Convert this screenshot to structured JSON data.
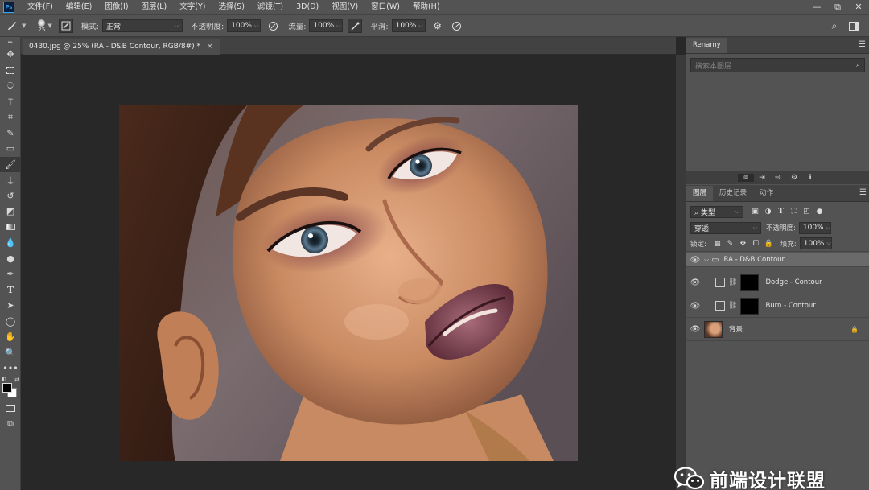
{
  "app": {
    "logo_text": "Ps"
  },
  "menu": [
    "文件(F)",
    "编辑(E)",
    "图像(I)",
    "图层(L)",
    "文字(Y)",
    "选择(S)",
    "滤镜(T)",
    "3D(D)",
    "视图(V)",
    "窗口(W)",
    "帮助(H)"
  ],
  "window_controls": {
    "minimize": "—",
    "restore": "⧉",
    "close": "✕"
  },
  "options_bar": {
    "brush_size": "25",
    "mode_label": "模式:",
    "mode_value": "正常",
    "opacity_label": "不透明度:",
    "opacity_value": "100%",
    "flow_label": "流量:",
    "flow_value": "100%",
    "smoothing_label": "平滑:",
    "smoothing_value": "100%"
  },
  "document": {
    "tab_title": "0430.jpg @ 25% (RA - D&B Contour, RGB/8#) *",
    "close_glyph": "×"
  },
  "renamy_panel": {
    "tab": "Renamy",
    "search_placeholder": "搜索本图层"
  },
  "layers_panel": {
    "tabs": [
      "图层",
      "历史记录",
      "动作"
    ],
    "filter_kind": "类型",
    "blend_mode": "穿透",
    "opacity_label": "不透明度:",
    "opacity_value": "100%",
    "lock_label": "锁定:",
    "fill_label": "填充:",
    "fill_value": "100%",
    "layers": [
      {
        "name": "RA - D&B Contour",
        "type": "group"
      },
      {
        "name": "Dodge - Contour",
        "type": "adjustment"
      },
      {
        "name": "Burn - Contour",
        "type": "adjustment"
      },
      {
        "name": "背景",
        "type": "background"
      }
    ]
  },
  "watermark": {
    "text": "前端设计联盟"
  },
  "colors": {
    "ui_dark": "#282828",
    "panel": "#535353",
    "accent": "#31a8ff"
  }
}
